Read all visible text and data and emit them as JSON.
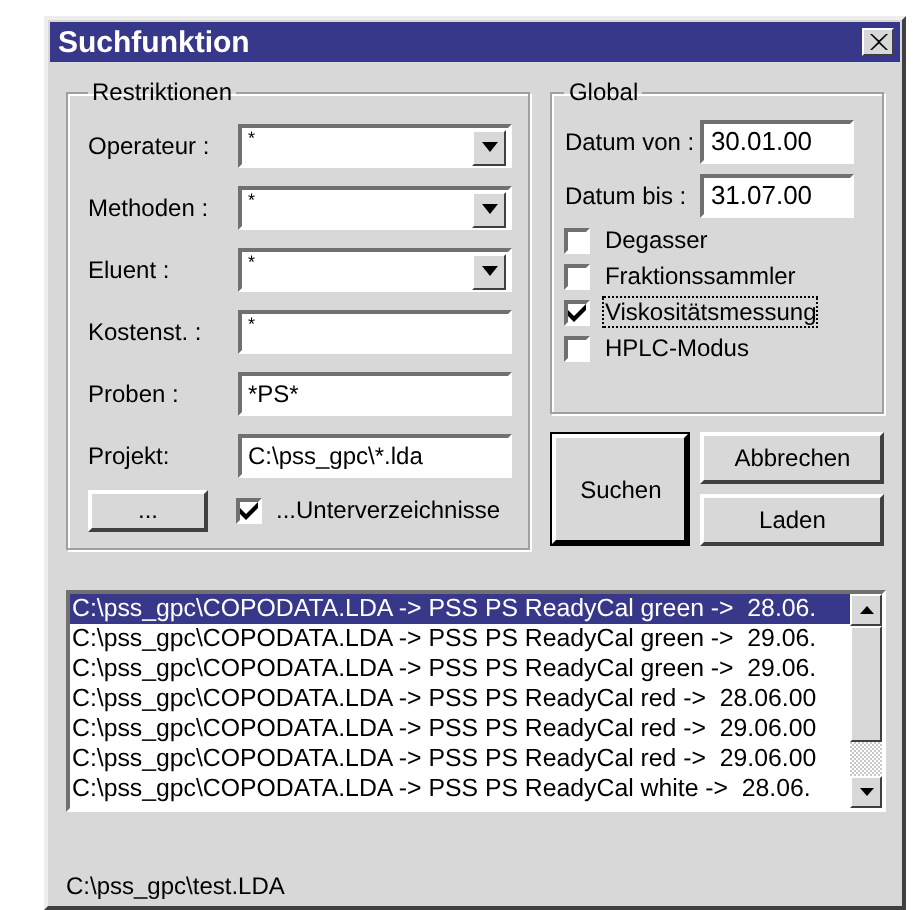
{
  "window": {
    "title": "Suchfunktion"
  },
  "restrictions": {
    "title": "Restriktionen",
    "fields": [
      {
        "kind": "combo",
        "label": "Operateur :",
        "value": "*"
      },
      {
        "kind": "combo",
        "label": "Methoden :",
        "value": "*"
      },
      {
        "kind": "combo",
        "label": "Eluent :",
        "value": "*"
      },
      {
        "kind": "text",
        "label": "Kostenst. :",
        "value": "*"
      },
      {
        "kind": "text",
        "label": "Proben :",
        "value": "*PS*"
      },
      {
        "kind": "text",
        "label": "Projekt:",
        "value": "C:\\pss_gpc\\*.lda"
      }
    ],
    "browse_button": "...",
    "subdirs": {
      "label": "...Unterverzeichnisse",
      "checked": true
    }
  },
  "global": {
    "title": "Global",
    "dates": [
      {
        "label": "Datum von :",
        "value": "30.01.00"
      },
      {
        "label": "Datum bis :",
        "value": "31.07.00"
      }
    ],
    "options": [
      {
        "label": "Degasser",
        "checked": false,
        "focused": false
      },
      {
        "label": "Fraktionssammler",
        "checked": false,
        "focused": false
      },
      {
        "label": "Viskositätsmessung",
        "checked": true,
        "focused": true
      },
      {
        "label": "HPLC-Modus",
        "checked": false,
        "focused": false
      }
    ]
  },
  "search_button": "Suchen",
  "cancel_button": "Abbrechen",
  "load_button": "Laden",
  "results": [
    {
      "text": "C:\\pss_gpc\\COPODATA.LDA -> PSS PS ReadyCal green ->  28.06.",
      "selected": true
    },
    {
      "text": "C:\\pss_gpc\\COPODATA.LDA -> PSS PS ReadyCal green ->  29.06.",
      "selected": false
    },
    {
      "text": "C:\\pss_gpc\\COPODATA.LDA -> PSS PS ReadyCal green ->  29.06.",
      "selected": false
    },
    {
      "text": "C:\\pss_gpc\\COPODATA.LDA -> PSS PS ReadyCal red ->  28.06.00",
      "selected": false
    },
    {
      "text": "C:\\pss_gpc\\COPODATA.LDA -> PSS PS ReadyCal red ->  29.06.00",
      "selected": false
    },
    {
      "text": "C:\\pss_gpc\\COPODATA.LDA -> PSS PS ReadyCal red ->  29.06.00",
      "selected": false
    },
    {
      "text": "C:\\pss_gpc\\COPODATA.LDA -> PSS PS ReadyCal white ->  28.06.",
      "selected": false
    }
  ],
  "status_bar": "C:\\pss_gpc\\test.LDA"
}
